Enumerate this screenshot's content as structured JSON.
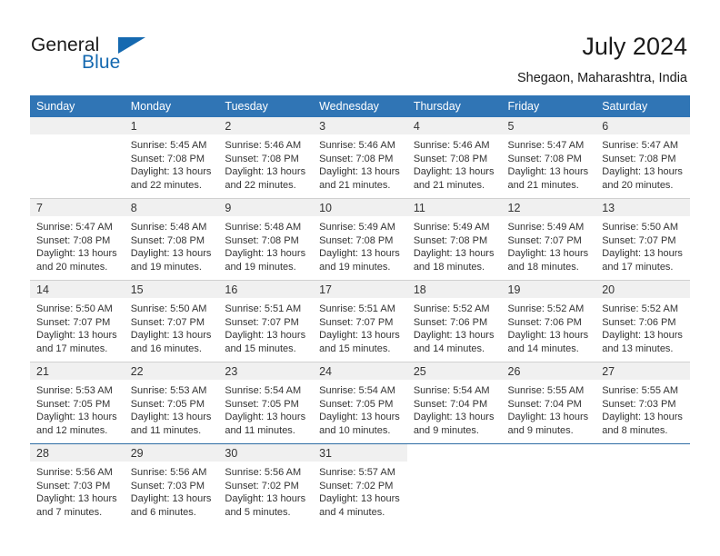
{
  "brand": {
    "name_part1": "General",
    "name_part2": "Blue",
    "accent_color": "#1569b0",
    "logo_icon": "triangle-icon"
  },
  "header": {
    "title": "July 2024",
    "subtitle": "Shegaon, Maharashtra, India"
  },
  "calendar": {
    "header_bg": "#3075b5",
    "daynum_band_bg": "#f0f0f0",
    "weekday_headers": [
      "Sunday",
      "Monday",
      "Tuesday",
      "Wednesday",
      "Thursday",
      "Friday",
      "Saturday"
    ],
    "weeks": [
      [
        {
          "day": "",
          "lines": []
        },
        {
          "day": "1",
          "lines": [
            "Sunrise: 5:45 AM",
            "Sunset: 7:08 PM",
            "Daylight: 13 hours",
            "and 22 minutes."
          ]
        },
        {
          "day": "2",
          "lines": [
            "Sunrise: 5:46 AM",
            "Sunset: 7:08 PM",
            "Daylight: 13 hours",
            "and 22 minutes."
          ]
        },
        {
          "day": "3",
          "lines": [
            "Sunrise: 5:46 AM",
            "Sunset: 7:08 PM",
            "Daylight: 13 hours",
            "and 21 minutes."
          ]
        },
        {
          "day": "4",
          "lines": [
            "Sunrise: 5:46 AM",
            "Sunset: 7:08 PM",
            "Daylight: 13 hours",
            "and 21 minutes."
          ]
        },
        {
          "day": "5",
          "lines": [
            "Sunrise: 5:47 AM",
            "Sunset: 7:08 PM",
            "Daylight: 13 hours",
            "and 21 minutes."
          ]
        },
        {
          "day": "6",
          "lines": [
            "Sunrise: 5:47 AM",
            "Sunset: 7:08 PM",
            "Daylight: 13 hours",
            "and 20 minutes."
          ]
        }
      ],
      [
        {
          "day": "7",
          "lines": [
            "Sunrise: 5:47 AM",
            "Sunset: 7:08 PM",
            "Daylight: 13 hours",
            "and 20 minutes."
          ]
        },
        {
          "day": "8",
          "lines": [
            "Sunrise: 5:48 AM",
            "Sunset: 7:08 PM",
            "Daylight: 13 hours",
            "and 19 minutes."
          ]
        },
        {
          "day": "9",
          "lines": [
            "Sunrise: 5:48 AM",
            "Sunset: 7:08 PM",
            "Daylight: 13 hours",
            "and 19 minutes."
          ]
        },
        {
          "day": "10",
          "lines": [
            "Sunrise: 5:49 AM",
            "Sunset: 7:08 PM",
            "Daylight: 13 hours",
            "and 19 minutes."
          ]
        },
        {
          "day": "11",
          "lines": [
            "Sunrise: 5:49 AM",
            "Sunset: 7:08 PM",
            "Daylight: 13 hours",
            "and 18 minutes."
          ]
        },
        {
          "day": "12",
          "lines": [
            "Sunrise: 5:49 AM",
            "Sunset: 7:07 PM",
            "Daylight: 13 hours",
            "and 18 minutes."
          ]
        },
        {
          "day": "13",
          "lines": [
            "Sunrise: 5:50 AM",
            "Sunset: 7:07 PM",
            "Daylight: 13 hours",
            "and 17 minutes."
          ]
        }
      ],
      [
        {
          "day": "14",
          "lines": [
            "Sunrise: 5:50 AM",
            "Sunset: 7:07 PM",
            "Daylight: 13 hours",
            "and 17 minutes."
          ]
        },
        {
          "day": "15",
          "lines": [
            "Sunrise: 5:50 AM",
            "Sunset: 7:07 PM",
            "Daylight: 13 hours",
            "and 16 minutes."
          ]
        },
        {
          "day": "16",
          "lines": [
            "Sunrise: 5:51 AM",
            "Sunset: 7:07 PM",
            "Daylight: 13 hours",
            "and 15 minutes."
          ]
        },
        {
          "day": "17",
          "lines": [
            "Sunrise: 5:51 AM",
            "Sunset: 7:07 PM",
            "Daylight: 13 hours",
            "and 15 minutes."
          ]
        },
        {
          "day": "18",
          "lines": [
            "Sunrise: 5:52 AM",
            "Sunset: 7:06 PM",
            "Daylight: 13 hours",
            "and 14 minutes."
          ]
        },
        {
          "day": "19",
          "lines": [
            "Sunrise: 5:52 AM",
            "Sunset: 7:06 PM",
            "Daylight: 13 hours",
            "and 14 minutes."
          ]
        },
        {
          "day": "20",
          "lines": [
            "Sunrise: 5:52 AM",
            "Sunset: 7:06 PM",
            "Daylight: 13 hours",
            "and 13 minutes."
          ]
        }
      ],
      [
        {
          "day": "21",
          "lines": [
            "Sunrise: 5:53 AM",
            "Sunset: 7:05 PM",
            "Daylight: 13 hours",
            "and 12 minutes."
          ]
        },
        {
          "day": "22",
          "lines": [
            "Sunrise: 5:53 AM",
            "Sunset: 7:05 PM",
            "Daylight: 13 hours",
            "and 11 minutes."
          ]
        },
        {
          "day": "23",
          "lines": [
            "Sunrise: 5:54 AM",
            "Sunset: 7:05 PM",
            "Daylight: 13 hours",
            "and 11 minutes."
          ]
        },
        {
          "day": "24",
          "lines": [
            "Sunrise: 5:54 AM",
            "Sunset: 7:05 PM",
            "Daylight: 13 hours",
            "and 10 minutes."
          ]
        },
        {
          "day": "25",
          "lines": [
            "Sunrise: 5:54 AM",
            "Sunset: 7:04 PM",
            "Daylight: 13 hours",
            "and 9 minutes."
          ]
        },
        {
          "day": "26",
          "lines": [
            "Sunrise: 5:55 AM",
            "Sunset: 7:04 PM",
            "Daylight: 13 hours",
            "and 9 minutes."
          ]
        },
        {
          "day": "27",
          "lines": [
            "Sunrise: 5:55 AM",
            "Sunset: 7:03 PM",
            "Daylight: 13 hours",
            "and 8 minutes."
          ]
        }
      ],
      [
        {
          "day": "28",
          "lines": [
            "Sunrise: 5:56 AM",
            "Sunset: 7:03 PM",
            "Daylight: 13 hours",
            "and 7 minutes."
          ]
        },
        {
          "day": "29",
          "lines": [
            "Sunrise: 5:56 AM",
            "Sunset: 7:03 PM",
            "Daylight: 13 hours",
            "and 6 minutes."
          ]
        },
        {
          "day": "30",
          "lines": [
            "Sunrise: 5:56 AM",
            "Sunset: 7:02 PM",
            "Daylight: 13 hours",
            "and 5 minutes."
          ]
        },
        {
          "day": "31",
          "lines": [
            "Sunrise: 5:57 AM",
            "Sunset: 7:02 PM",
            "Daylight: 13 hours",
            "and 4 minutes."
          ]
        },
        {
          "day": "",
          "lines": []
        },
        {
          "day": "",
          "lines": []
        },
        {
          "day": "",
          "lines": []
        }
      ]
    ]
  }
}
